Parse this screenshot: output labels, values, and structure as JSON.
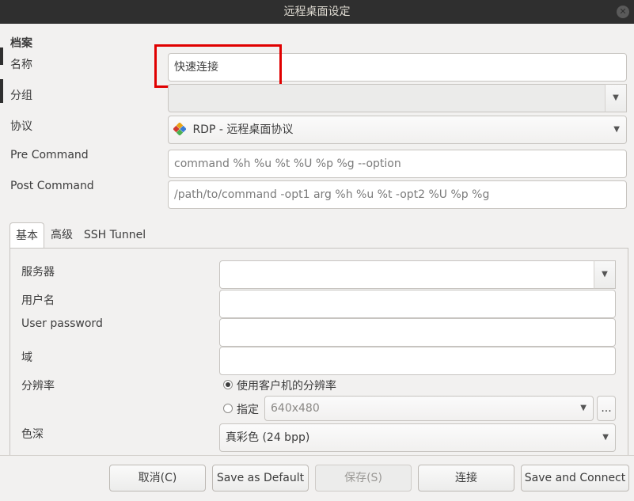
{
  "window": {
    "title": "远程桌面设定",
    "close_glyph": "✕"
  },
  "profile": {
    "section_label": "档案",
    "name_label": "名称",
    "name_value": "快速连接",
    "group_label": "分组",
    "group_value": "",
    "protocol_label": "协议",
    "protocol_value": "RDP - 远程桌面协议",
    "protocol_icon": "rdp-protocol-icon",
    "pre_command_label": "Pre Command",
    "pre_command_placeholder": "command %h %u %t %U %p %g --option",
    "post_command_label": "Post Command",
    "post_command_placeholder": "/path/to/command -opt1 arg %h %u %t -opt2 %U %p %g"
  },
  "tabs": [
    "基本",
    "高级",
    "SSH Tunnel"
  ],
  "basic": {
    "server_label": "服务器",
    "server_value": "",
    "username_label": "用户名",
    "username_value": "",
    "password_label": "User password",
    "password_value": "",
    "domain_label": "域",
    "domain_value": "",
    "resolution_label": "分辨率",
    "resolution_option_client": "使用客户机的分辨率",
    "resolution_option_custom": "指定",
    "resolution_custom_value": "640x480",
    "resolution_more": "...",
    "color_depth_label": "色深",
    "color_depth_value": "真彩色 (24 bpp)"
  },
  "buttons": {
    "cancel": "取消(C)",
    "save_default": "Save as Default",
    "save": "保存(S)",
    "connect": "连接",
    "save_connect": "Save and Connect"
  },
  "colors": {
    "titlebar": "#2f2f2f",
    "highlight": "#e00000",
    "window_bg": "#f2f1f0"
  }
}
